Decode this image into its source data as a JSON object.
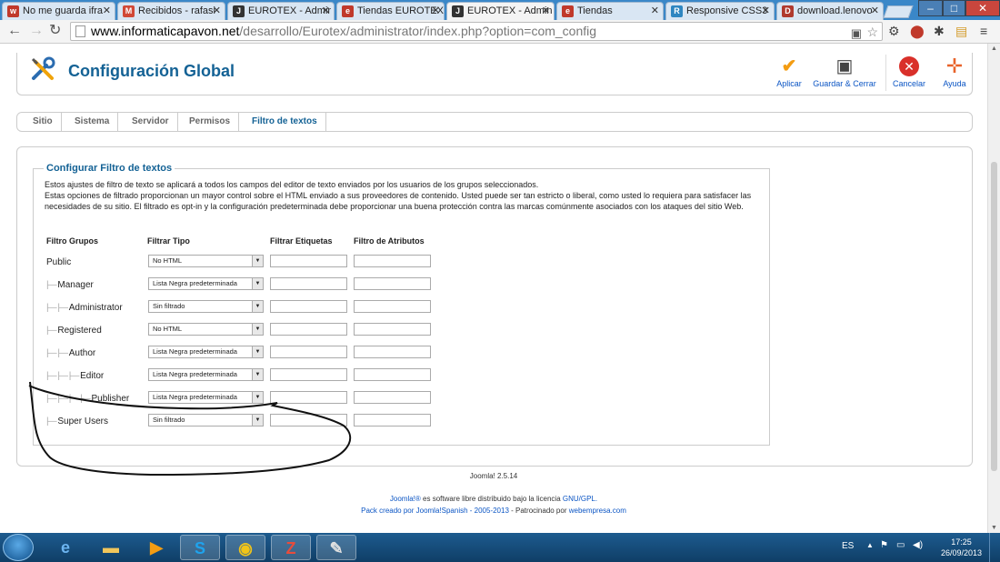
{
  "browser": {
    "tabs": [
      {
        "label": "No me guarda ifra",
        "fav": "w",
        "color": "#c0392b"
      },
      {
        "label": "Recibidos - rafasi",
        "fav": "M",
        "color": "#d14836"
      },
      {
        "label": "EUROTEX - Admir",
        "fav": "J",
        "color": "#333333"
      },
      {
        "label": "Tiendas EUROTEX",
        "fav": "e",
        "color": "#c0392b"
      },
      {
        "label": "EUROTEX - Admin",
        "fav": "J",
        "color": "#333333"
      },
      {
        "label": "Tiendas",
        "fav": "e",
        "color": "#c0392b"
      },
      {
        "label": "Responsive CSS3",
        "fav": "R",
        "color": "#2e86c1"
      },
      {
        "label": "download.lenovo",
        "fav": "D",
        "color": "#b03a2e"
      }
    ],
    "url_domain": "www.informaticapavon.net",
    "url_path": "/desarrollo/Eurotex/administrator/index.php?option=com_config"
  },
  "header": {
    "title": "Configuración Global",
    "buttons": {
      "apply": "Aplicar",
      "save_close": "Guardar & Cerrar",
      "cancel": "Cancelar",
      "help": "Ayuda"
    }
  },
  "subnav": {
    "tabs": [
      "Sitio",
      "Sistema",
      "Servidor",
      "Permisos",
      "Filtro de textos"
    ]
  },
  "filter": {
    "legend": "Configurar Filtro de textos",
    "desc1": "Estos ajustes de filtro de texto se aplicará a todos los campos del editor de texto enviados por los usuarios de los grupos seleccionados.",
    "desc2": "Estas opciones de filtrado proporcionan un mayor control sobre el HTML enviado a sus proveedores de contenido. Usted puede ser tan estricto o liberal, como usted lo requiera para satisfacer las necesidades de su sitio. El filtrado es opt-in y la configuración predeterminada debe proporcionar una buena protección contra las marcas comúnmente asociados con los ataques del sitio Web.",
    "col_group": "Filtro Grupos",
    "col_type": "Filtrar Tipo",
    "col_tags": "Filtrar Etiquetas",
    "col_attrs": "Filtro de Atributos",
    "rows": [
      {
        "group": "Public",
        "tree": "",
        "type": "No HTML"
      },
      {
        "group": "Manager",
        "tree": "|— ",
        "type": "Lista Negra predeterminada"
      },
      {
        "group": "Administrator",
        "tree": "|— |— ",
        "type": "Sin filtrado"
      },
      {
        "group": "Registered",
        "tree": "|— ",
        "type": "No HTML"
      },
      {
        "group": "Author",
        "tree": "|— |— ",
        "type": "Lista Negra predeterminada"
      },
      {
        "group": "Editor",
        "tree": "|— |— |— ",
        "type": "Lista Negra predeterminada"
      },
      {
        "group": "Publisher",
        "tree": "|— |— |— |— ",
        "type": "Lista Negra predeterminada"
      },
      {
        "group": "Super Users",
        "tree": "|— ",
        "type": "Sin filtrado"
      }
    ]
  },
  "footer": {
    "version": "Joomla! 2.5.14",
    "license_link": "Joomla!®",
    "license_text": " es software libre distribuido bajo la licencia ",
    "license_gpl": "GNU/GPL.",
    "pack_link": "Pack creado por Joomla!Spanish - 2005-2013",
    "pack_text": " - Patrocinado por ",
    "sponsor_link": "webempresa.com"
  },
  "taskbar": {
    "lang": "ES",
    "time": "17:25",
    "date": "26/09/2013"
  }
}
